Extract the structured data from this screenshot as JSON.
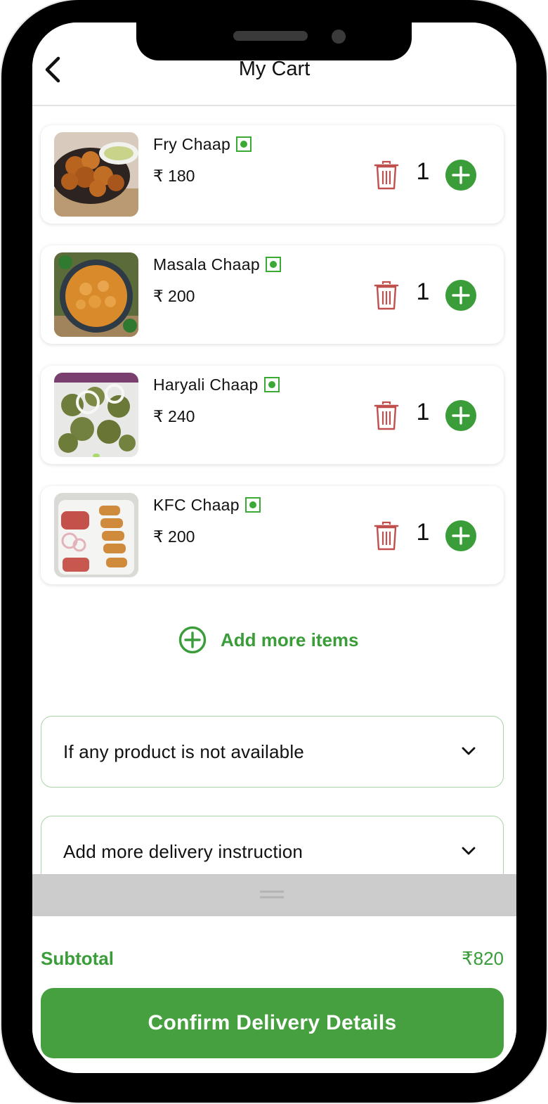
{
  "header": {
    "title": "My Cart",
    "back_icon": "chevron-left-icon"
  },
  "cart": {
    "items": [
      {
        "name": "Fry Chaap",
        "price": "₹ 180",
        "quantity": "1",
        "image": "fry-chaap-photo"
      },
      {
        "name": "Masala Chaap",
        "price": "₹ 200",
        "quantity": "1",
        "image": "masala-chaap-photo"
      },
      {
        "name": "Haryali Chaap",
        "price": "₹ 240",
        "quantity": "1",
        "image": "haryali-chaap-photo"
      },
      {
        "name": "KFC Chaap",
        "price": "₹ 200",
        "quantity": "1",
        "image": "kfc-chaap-photo"
      }
    ],
    "add_more_label": "Add more items"
  },
  "options": {
    "unavailable_label": "If any product is not available",
    "delivery_instruction_label": "Add more delivery instruction"
  },
  "summary": {
    "subtotal_label": "Subtotal",
    "subtotal_value": "₹820",
    "confirm_label": "Confirm Delivery Details"
  },
  "colors": {
    "accent": "#3a9d3a",
    "delete": "#c0504d",
    "veg": "#3aaa35"
  }
}
